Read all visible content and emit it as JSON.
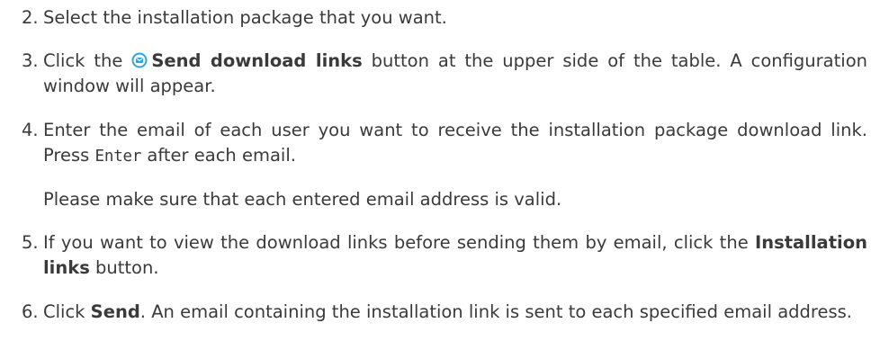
{
  "steps": [
    {
      "number": "2.",
      "text": "Select the installation package that you want."
    },
    {
      "number": "3.",
      "pre": "Click the ",
      "button_label": "Send download links",
      "post": " button at the upper side of the table. A configuration window will appear.",
      "icon": "send-email-icon"
    },
    {
      "number": "4.",
      "pre": "Enter the email of each user you want to receive the installation package download link. Press ",
      "key": "Enter",
      "post": " after each email."
    },
    {
      "note": "Please make sure that each entered email address is valid."
    },
    {
      "number": "5.",
      "pre": "If you want to view the download links before sending them by email, click the ",
      "button_label": "Installation links",
      "post": " button."
    },
    {
      "number": "6.",
      "pre": "Click ",
      "button_label": "Send",
      "post": ". An email containing the installation link is sent to each specified email address."
    }
  ],
  "colors": {
    "text": "#3a3a3a",
    "icon_accent": "#2ba6de"
  }
}
